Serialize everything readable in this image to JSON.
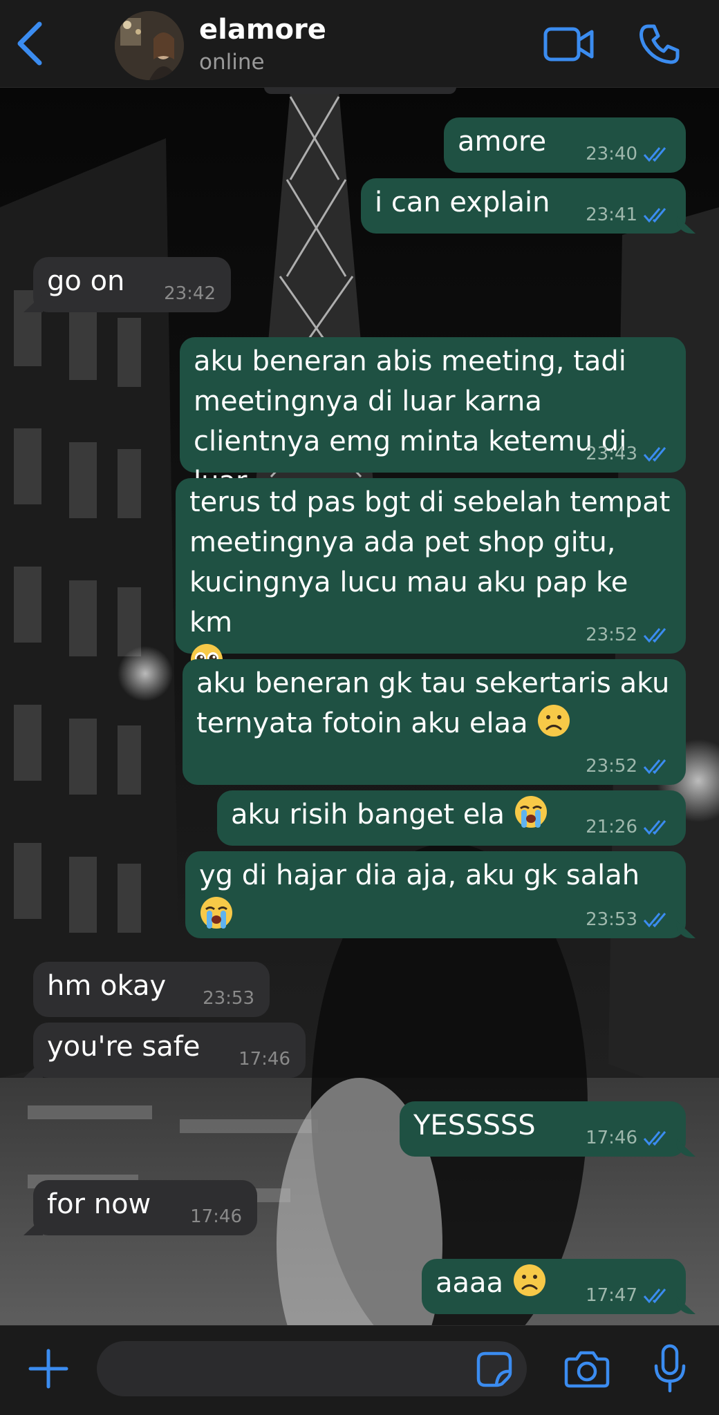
{
  "header": {
    "contact_name": "elamore",
    "status": "online"
  },
  "icons": {
    "back": "back-chevron-icon",
    "video": "video-camera-icon",
    "call": "phone-icon",
    "plus": "plus-icon",
    "sticker": "sticker-icon",
    "camera": "camera-icon",
    "mic": "microphone-icon",
    "read_receipt": "double-check-icon"
  },
  "colors": {
    "accent": "#3b8cf0",
    "outgoing_bubble": "#1f5143",
    "incoming_bubble": "#2e2e30",
    "header_bg": "#1b1b1b"
  },
  "messages": [
    {
      "direction": "out",
      "text": "amore",
      "time": "23:40",
      "read": true
    },
    {
      "direction": "out",
      "text": "i can explain",
      "time": "23:41",
      "read": true
    },
    {
      "direction": "in",
      "text": "go on",
      "time": "23:42"
    },
    {
      "direction": "out",
      "text": "aku beneran abis meeting, tadi meetingnya di luar karna clientnya emg minta ketemu di luar",
      "time": "23:43",
      "read": true
    },
    {
      "direction": "out",
      "text": "terus td pas bgt di sebelah tempat meetingnya ada pet shop gitu, kucingnya lucu mau aku pap ke km",
      "emoji": "pleading-face",
      "time": "23:52",
      "read": true
    },
    {
      "direction": "out",
      "text": "aku beneran gk tau sekertaris aku ternyata fotoin aku elaa",
      "emoji": "frowning-face",
      "time": "23:52",
      "read": true
    },
    {
      "direction": "out",
      "text": "aku risih banget ela",
      "emoji": "loudly-crying-face",
      "time": "21:26",
      "read": true
    },
    {
      "direction": "out",
      "text": "yg di hajar dia aja, aku gk salah",
      "emoji": "loudly-crying-face",
      "time": "23:53",
      "read": true
    },
    {
      "direction": "in",
      "text": "hm okay",
      "time": "23:53"
    },
    {
      "direction": "in",
      "text": "you're safe",
      "time": "17:46"
    },
    {
      "direction": "out",
      "text": "YESSSSS",
      "time": "17:46",
      "read": true
    },
    {
      "direction": "in",
      "text": "for now",
      "time": "17:46"
    },
    {
      "direction": "out",
      "text": "aaaa",
      "emoji": "frowning-face",
      "time": "17:47",
      "read": true
    }
  ],
  "composer": {
    "value": ""
  }
}
